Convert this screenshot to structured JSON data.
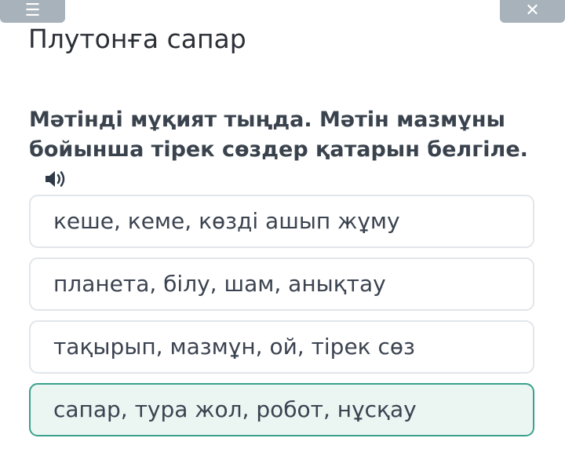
{
  "header": {
    "left_button_icon": "menu-icon",
    "right_button_icon": "close-icon"
  },
  "title": "Плутонға сапар",
  "question": {
    "text": "Мәтінді мұқият тыңда. Мәтін мазмұны бойынша тірек сөздер қатарын белгіле.",
    "audio_icon": "speaker-icon"
  },
  "options": [
    {
      "label": "кеше, кеме, көзді ашып жұму",
      "selected": false
    },
    {
      "label": "планета, білу, шам, анықтау",
      "selected": false
    },
    {
      "label": "тақырып, мазмұн, ой, тірек сөз",
      "selected": false
    },
    {
      "label": "сапар, тура жол, робот, нұсқау",
      "selected": true
    }
  ],
  "colors": {
    "top_button": "#a7b2ba",
    "selected_border": "#3aa18c",
    "selected_background": "#ebf6f3",
    "option_border": "#e2e6ea"
  }
}
